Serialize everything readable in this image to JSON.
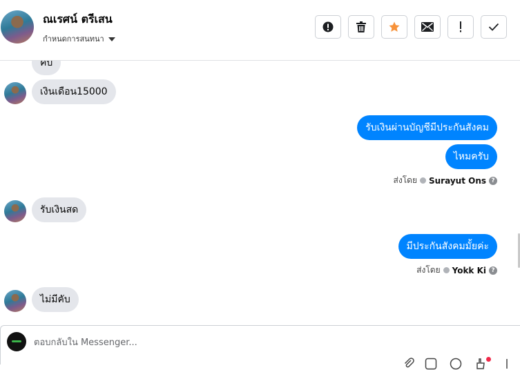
{
  "header": {
    "contact_name": "ณเรศน์ ตรีเสน",
    "assign_label": "กำหนดการสนทนา",
    "actions": [
      {
        "name": "report-button",
        "icon": "exclamation-circle-icon"
      },
      {
        "name": "delete-button",
        "icon": "trash-icon"
      },
      {
        "name": "star-button",
        "icon": "star-icon",
        "color": "#f7923a"
      },
      {
        "name": "mark-unread-button",
        "icon": "envelope-icon"
      },
      {
        "name": "follow-up-button",
        "icon": "exclamation-icon"
      },
      {
        "name": "mark-done-button",
        "icon": "check-icon"
      }
    ]
  },
  "messages": [
    {
      "direction": "in",
      "text": "คับ"
    },
    {
      "direction": "in",
      "text": "เงินเดือน15000"
    },
    {
      "direction": "out",
      "text": "รับเงินผ่านบัญชีมีประกันสังคม"
    },
    {
      "direction": "out",
      "text": "ไหมครับ"
    },
    {
      "direction": "in",
      "text": "รับเงินสด"
    },
    {
      "direction": "out",
      "text": "มีประกันสังคมมั้ยค่ะ"
    },
    {
      "direction": "in",
      "text": "ไม่มีคับ"
    }
  ],
  "sent_by": [
    {
      "label": "ส่งโดย",
      "name": "Surayut Ons"
    },
    {
      "label": "ส่งโดย",
      "name": "Yokk Ki"
    }
  ],
  "composer": {
    "placeholder": "ตอบกลับใน Messenger..."
  },
  "colors": {
    "outgoing_bubble": "#0084ff",
    "incoming_bubble": "#e4e6eb",
    "star": "#f7923a"
  }
}
